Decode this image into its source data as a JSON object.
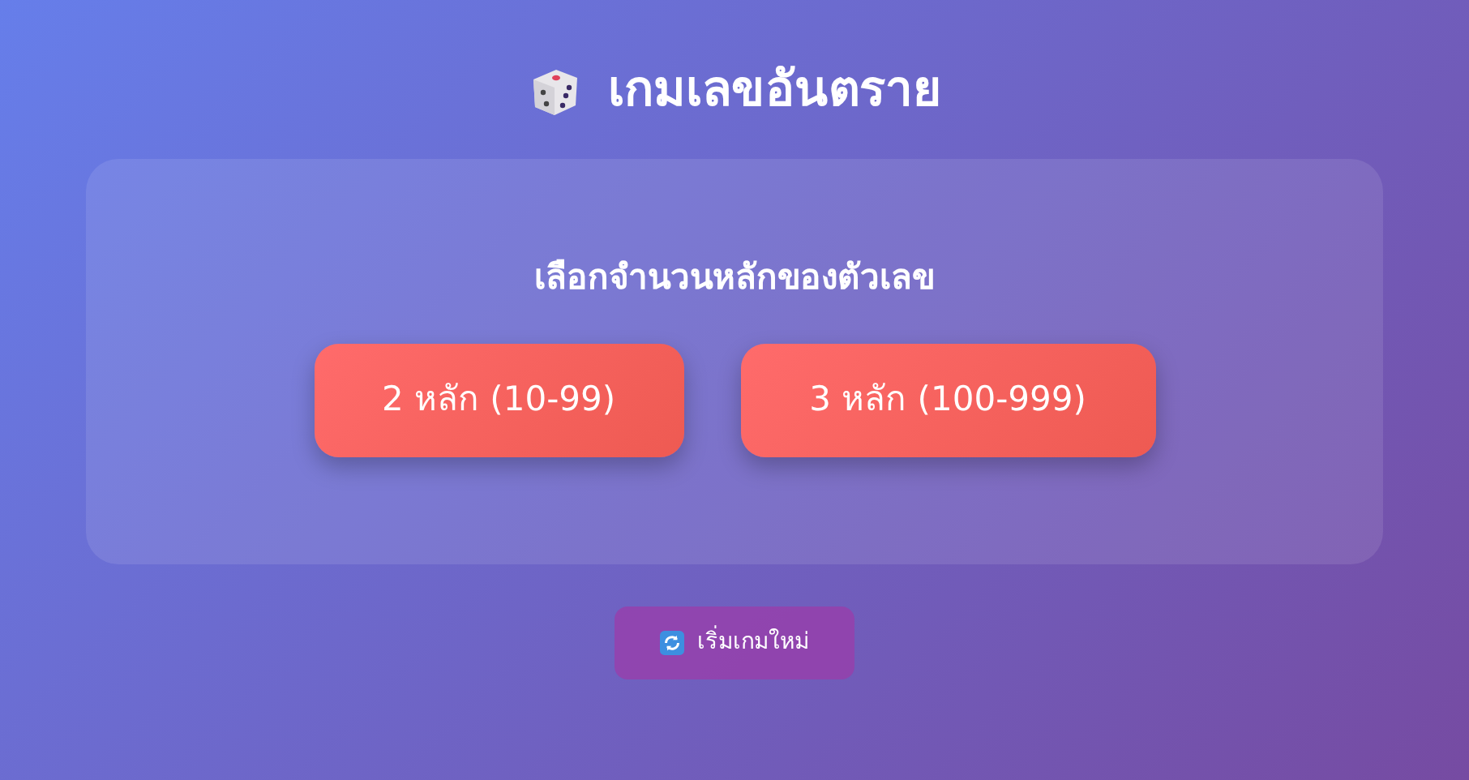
{
  "title": "เกมเลขอันตราย",
  "panel": {
    "heading": "เลือกจำนวนหลักของตัวเลข",
    "options": [
      {
        "label": "2 หลัก (10-99)"
      },
      {
        "label": "3 หลัก (100-999)"
      }
    ]
  },
  "reset_button": "เริ่มเกมใหม่"
}
